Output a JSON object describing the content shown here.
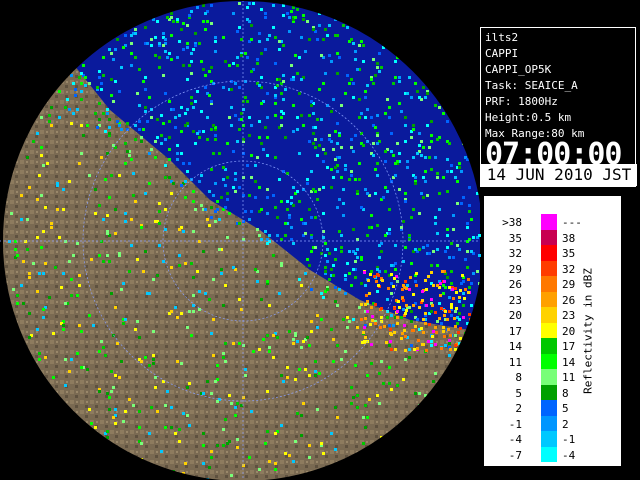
{
  "info": {
    "lines": [
      "ilts2",
      "CAPPI",
      "CAPPI_OP5K",
      "Task: SEAICE_A",
      "PRF: 1800Hz",
      "Height:0.5 km",
      "Max Range:80 km"
    ],
    "time": "07:00:00",
    "date": "14 JUN 2010 JST"
  },
  "legend": {
    "title": "Reflectivity in dBZ",
    "rows": [
      {
        "lo": ">38",
        "hi": "---",
        "color": "#ff00ff"
      },
      {
        "lo": "35",
        "hi": "38",
        "color": "#c80050"
      },
      {
        "lo": "32",
        "hi": "35",
        "color": "#ff0000"
      },
      {
        "lo": "29",
        "hi": "32",
        "color": "#ff3c00"
      },
      {
        "lo": "26",
        "hi": "29",
        "color": "#ff7800"
      },
      {
        "lo": "23",
        "hi": "26",
        "color": "#ffa000"
      },
      {
        "lo": "20",
        "hi": "23",
        "color": "#ffd200"
      },
      {
        "lo": "17",
        "hi": "20",
        "color": "#ffff00"
      },
      {
        "lo": "14",
        "hi": "17",
        "color": "#00c800"
      },
      {
        "lo": "11",
        "hi": "14",
        "color": "#00ff00"
      },
      {
        "lo": "8",
        "hi": "11",
        "color": "#78ff78"
      },
      {
        "lo": "5",
        "hi": "8",
        "color": "#00a000"
      },
      {
        "lo": "2",
        "hi": "5",
        "color": "#0064ff"
      },
      {
        "lo": "-1",
        "hi": "2",
        "color": "#0096ff"
      },
      {
        "lo": "-4",
        "hi": "-1",
        "color": "#00c8ff"
      },
      {
        "lo": "-7",
        "hi": "-4",
        "color": "#00ffff"
      }
    ]
  },
  "colors": {
    "sea": "#1e3cb4",
    "land": "#7a6a52",
    "outside": "#0000cc"
  }
}
